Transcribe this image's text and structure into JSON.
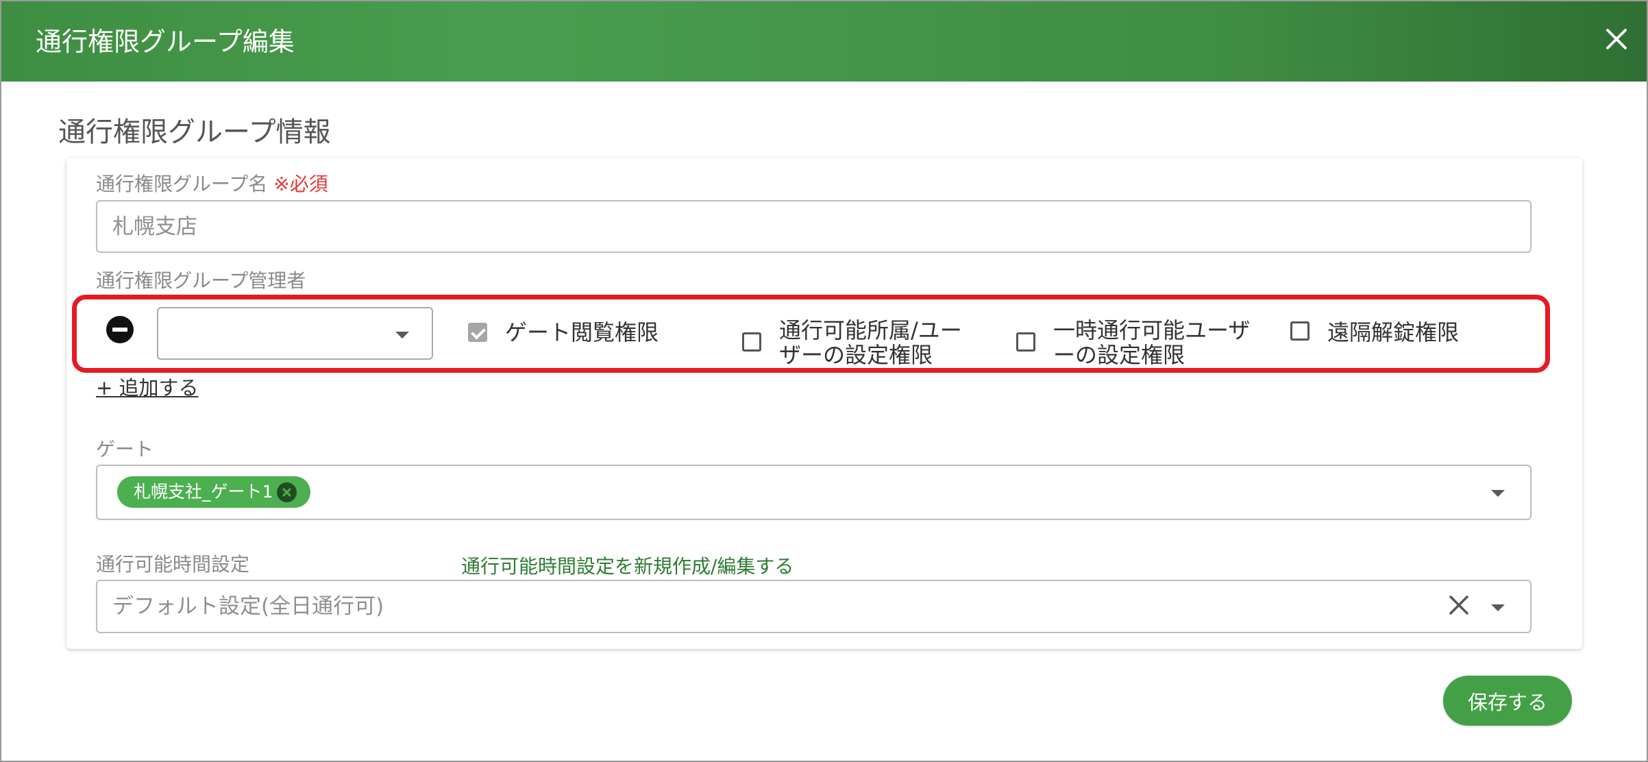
{
  "dialog": {
    "title": "通行権限グループ編集",
    "close_icon": "close-icon"
  },
  "section": {
    "title": "通行権限グループ情報"
  },
  "group_name": {
    "label": "通行権限グループ名",
    "required_mark": "※必須",
    "value": "札幌支店"
  },
  "admin": {
    "label": "通行権限グループ管理者",
    "select_value": "",
    "permissions": [
      {
        "label": "ゲート閲覧権限",
        "checked": true
      },
      {
        "line1": "通行可能所属/ユー",
        "line2": "ザーの設定権限",
        "checked": false
      },
      {
        "line1": "一時通行可能ユーザ",
        "line2": "ーの設定権限",
        "checked": false
      },
      {
        "label": "遠隔解錠権限",
        "checked": false
      }
    ],
    "add_link": "+ 追加する"
  },
  "gate": {
    "label": "ゲート",
    "chips": [
      {
        "label": "札幌支社_ゲート1"
      }
    ]
  },
  "time_setting": {
    "label": "通行可能時間設定",
    "link": "通行可能時間設定を新規作成/編集する",
    "value": "デフォルト設定(全日通行可)"
  },
  "footer": {
    "save_label": "保存する"
  },
  "colors": {
    "header_green": "#3e8e41",
    "accent_green": "#4caf50",
    "required_red": "#e53935",
    "highlight_red": "#e51b23"
  }
}
